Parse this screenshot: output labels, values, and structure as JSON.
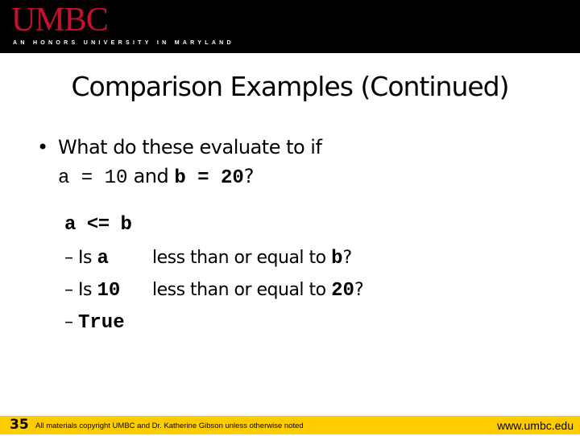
{
  "header": {
    "logo": "UMBC",
    "tagline": "AN HONORS UNIVERSITY IN MARYLAND",
    "logo_color": "#c8102e"
  },
  "slide": {
    "title": "Comparison Examples (Continued)",
    "bullet": {
      "line1": "What do these evaluate to if",
      "a_assign": "a = 10",
      "and": "and",
      "b_assign": "b = 20",
      "qmark": "?"
    },
    "expression": "a <= b",
    "steps": [
      {
        "dash": "–",
        "prefix": "Is",
        "code": "a",
        "text": "less than or equal to",
        "code2": "b",
        "suffix": "?"
      },
      {
        "dash": "–",
        "prefix": "Is",
        "code": "10",
        "text": "less than or equal to",
        "code2": "20",
        "suffix": "?"
      },
      {
        "dash": "–",
        "code": "True"
      }
    ]
  },
  "footer": {
    "slide_number": "35",
    "copyright": "All materials copyright UMBC and Dr. Katherine Gibson unless otherwise noted",
    "url": "www.umbc.edu",
    "bar_color": "#ffcc00"
  }
}
